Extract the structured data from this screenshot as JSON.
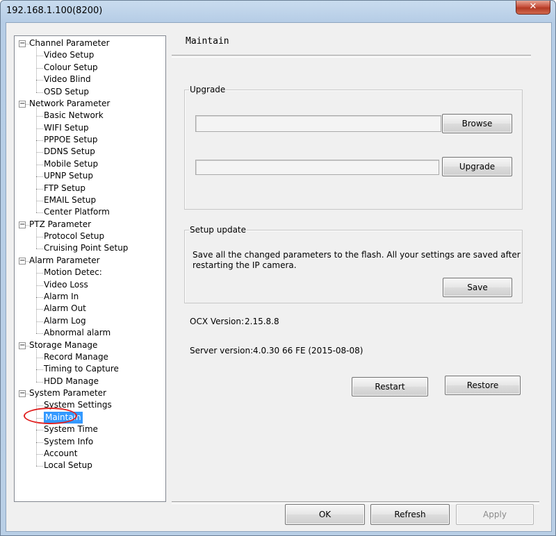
{
  "window": {
    "title": "192.168.1.100(8200)",
    "close_glyph": "✕"
  },
  "tree": {
    "groups": [
      {
        "label": "Channel Parameter",
        "items": [
          "Video Setup",
          "Colour Setup",
          "Video Blind",
          "OSD Setup"
        ]
      },
      {
        "label": "Network Parameter",
        "items": [
          "Basic Network",
          "WIFI Setup",
          "PPPOE Setup",
          "DDNS Setup",
          "Mobile Setup",
          "UPNP Setup",
          "FTP Setup",
          "EMAIL Setup",
          "Center Platform"
        ]
      },
      {
        "label": "PTZ Parameter",
        "items": [
          "Protocol Setup",
          "Cruising Point Setup"
        ]
      },
      {
        "label": "Alarm Parameter",
        "items": [
          "Motion Detec:",
          "Video Loss",
          "Alarm In",
          "Alarm Out",
          "Alarm Log",
          "Abnormal alarm"
        ]
      },
      {
        "label": "Storage Manage",
        "items": [
          "Record Manage",
          "Timing to Capture",
          "HDD Manage"
        ]
      },
      {
        "label": "System Parameter",
        "items": [
          "System Settings",
          "Maintain",
          "System Time",
          "System Info",
          "Account",
          "Local Setup"
        ]
      }
    ],
    "expander_glyph": "−",
    "selected": "Maintain",
    "highlight_color": "#e02020"
  },
  "main": {
    "page_title": "Maintain",
    "upgrade": {
      "caption": "Upgrade",
      "file_value": "",
      "progress_value": "",
      "browse_label": "Browse",
      "upgrade_label": "Upgrade"
    },
    "setup_update": {
      "caption": "Setup update",
      "description_line1": "Save all the changed parameters to the flash. All your settings are saved after",
      "description_line2": "restarting the IP camera.",
      "save_label": "Save"
    },
    "ocx_version_label": "OCX Version:",
    "ocx_version_value": "2.15.8.8",
    "server_version_label": "Server version:",
    "server_version_value": "4.0.30 66 FE (2015-08-08)",
    "restart_label": "Restart",
    "restore_label": "Restore"
  },
  "footer": {
    "ok_label": "OK",
    "refresh_label": "Refresh",
    "apply_label": "Apply"
  }
}
